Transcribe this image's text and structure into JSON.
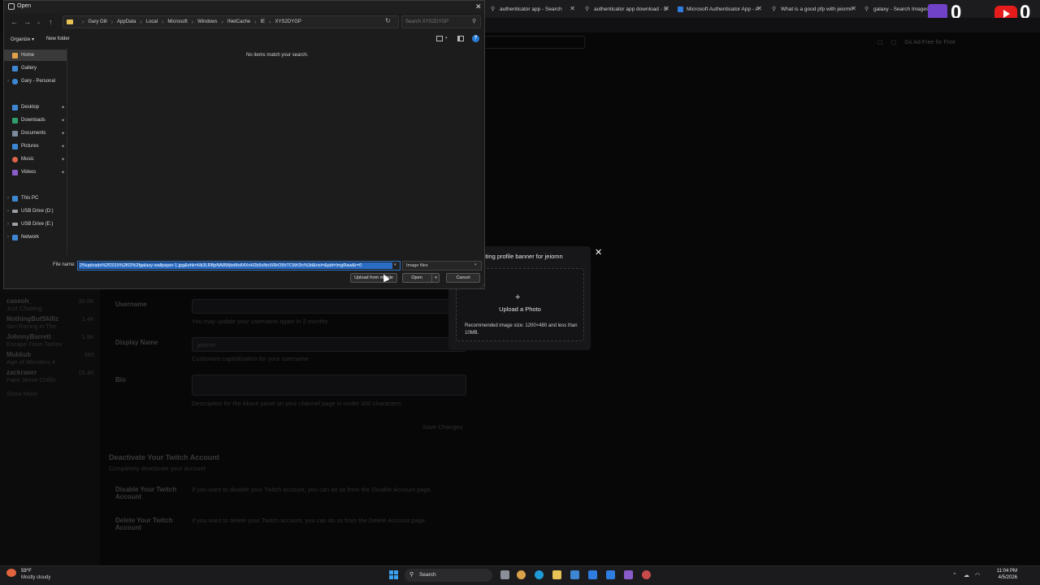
{
  "browser": {
    "tabs": [
      {
        "label": "authenticator app - Search"
      },
      {
        "label": "authenticator app download - S"
      },
      {
        "label": "Microsoft Authenticator App - A"
      },
      {
        "label": "What is a good pfp with jeiomn"
      },
      {
        "label": "galaxy - Search Images"
      }
    ],
    "twitch_count": "0",
    "youtube_count": "0",
    "go_ad_free": "Go Ad-Free for Free"
  },
  "dialog": {
    "title": "Open",
    "breadcrumbs": [
      "Gary Gill",
      "AppData",
      "Local",
      "Microsoft",
      "Windows",
      "INetCache",
      "IE",
      "XYS2DYGP"
    ],
    "search_placeholder": "Search XYS2DYGP",
    "organize_label": "Organize",
    "new_folder_label": "New folder",
    "empty_message": "No items match your search.",
    "nav_items": [
      {
        "label": "Home",
        "icon": "home-icon",
        "selected": true
      },
      {
        "label": "Gallery",
        "icon": "gallery-icon"
      },
      {
        "label": "Gary - Personal",
        "icon": "cloud-icon"
      },
      {
        "label": "Desktop",
        "icon": "desktop-icon"
      },
      {
        "label": "Downloads",
        "icon": "downloads-icon"
      },
      {
        "label": "Documents",
        "icon": "documents-icon"
      },
      {
        "label": "Pictures",
        "icon": "pictures-icon"
      },
      {
        "label": "Music",
        "icon": "music-icon"
      },
      {
        "label": "Videos",
        "icon": "videos-icon"
      },
      {
        "label": "This PC",
        "icon": "pc-icon"
      },
      {
        "label": "USB Drive (D:)",
        "icon": "usb-icon"
      },
      {
        "label": "USB Drive (E:)",
        "icon": "usb-icon"
      },
      {
        "label": "Network",
        "icon": "network-icon"
      }
    ],
    "file_name_label": "File name:",
    "file_name_value": "2%uploads%2f2015%2f02%2fgalaxy-wallpaper-1.jpg&ehk=Hk3LRBpNA8WjteMo64XnH2b5vNnXiRrO5hTCWr2Ic%3d&risl=&pid=ImgRaw&r=0",
    "file_type": "Image files",
    "upload_mobile_label": "Upload from mobile",
    "open_label": "Open",
    "cancel_label": "Cancel"
  },
  "banner_modal": {
    "title": "iting profile banner for jeiomn",
    "upload_label": "Upload a Photo",
    "recommendation": "Recommended image size: 1200×480 and less than 10MB."
  },
  "settings_page": {
    "username_label": "Username",
    "username_hint": "You may update your username again in 2 months",
    "display_name_label": "Display Name",
    "display_name_value": "jeiomn",
    "display_name_hint": "Customize capitalization for your username",
    "bio_label": "Bio",
    "bio_hint": "Description for the About panel on your channel page in under 300 characters",
    "save_label": "Save Changes",
    "deactivate_title": "Deactivate Your Twitch Account",
    "deactivate_sub": "Completely deactivate your account",
    "disable_label": "Disable Your Twitch Account",
    "disable_text": "If you want to disable your Twitch account, you can do so from the Disable Account page.",
    "delete_label": "Delete Your Twitch Account",
    "delete_text": "If you want to delete your Twitch account, you can do so from the Delete Account page."
  },
  "sidebar_channels": [
    {
      "name": "caseoh_",
      "sub": "Just Chatting",
      "count": "30.8K"
    },
    {
      "name": "NothingButSkillz",
      "sub": "Sim Racing in The",
      "count": "1.4K"
    },
    {
      "name": "JohnnyBarrett",
      "sub": "Escape From Tarkov",
      "count": "1.9K"
    },
    {
      "name": "Mukkub",
      "sub": "Age of Wonders 4",
      "count": "385"
    },
    {
      "name": "zackrawrr",
      "sub": "Fake Jesse Chillin",
      "count": "15.4K"
    }
  ],
  "sidebar_show_more": "Show More",
  "taskbar": {
    "temperature": "59°F",
    "weather": "Mostly cloudy",
    "search_label": "Search",
    "time": "11:04 PM",
    "date": "4/5/2026"
  }
}
